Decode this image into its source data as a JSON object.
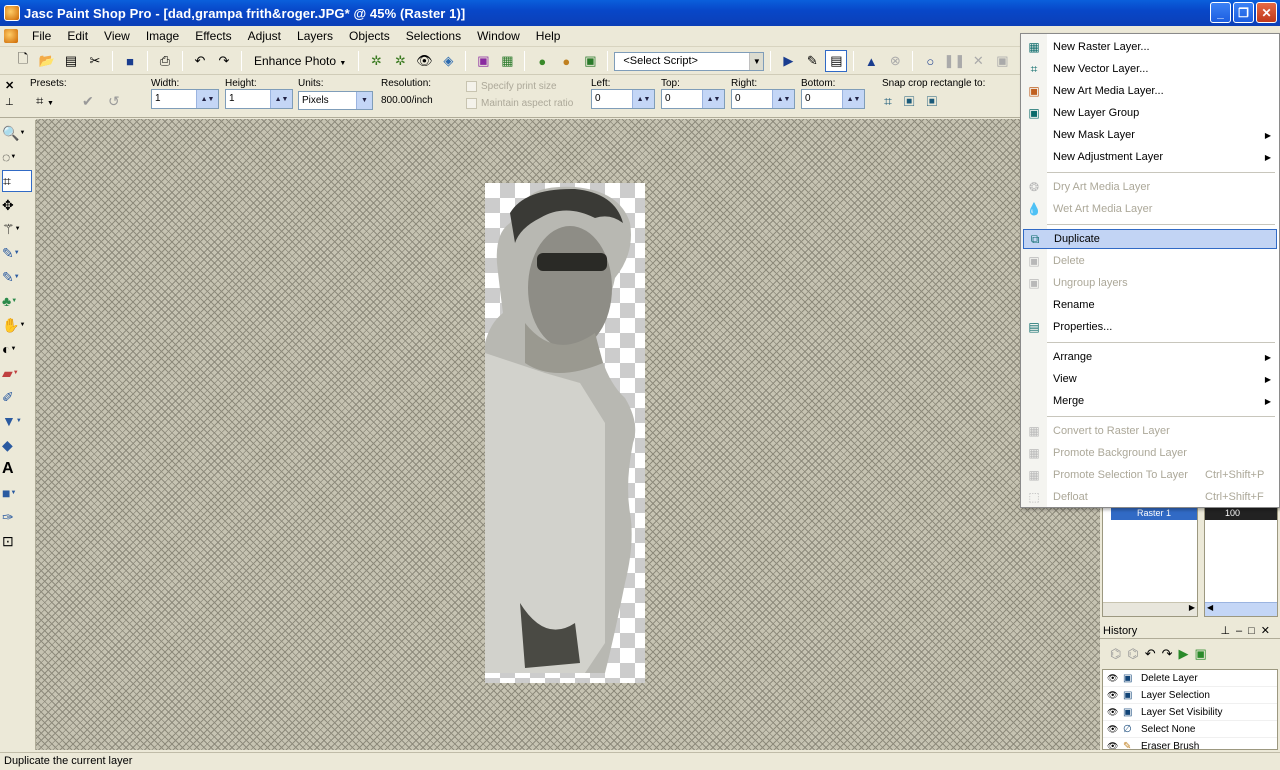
{
  "window": {
    "title": "Jasc Paint Shop Pro - [dad,grampa frith&roger.JPG* @  45% (Raster 1)]",
    "min": "_",
    "max": "❐",
    "close": "✕"
  },
  "menubar": [
    "File",
    "Edit",
    "View",
    "Image",
    "Effects",
    "Adjust",
    "Layers",
    "Objects",
    "Selections",
    "Window",
    "Help"
  ],
  "toolbar": {
    "enhance": "Enhance Photo",
    "enhance_arrow": "▼",
    "script": "<Select Script>"
  },
  "options": {
    "presets_label": "Presets:",
    "width_label": "Width:",
    "width_val": "1",
    "height_label": "Height:",
    "height_val": "1",
    "units_label": "Units:",
    "units_val": "Pixels",
    "resolution_label": "Resolution:",
    "resolution_val": "800.00/inch",
    "specify_print": "Specify print size",
    "maintain_aspect": "Maintain aspect ratio",
    "left_label": "Left:",
    "left_val": "0",
    "top_label": "Top:",
    "top_val": "0",
    "right_label": "Right:",
    "right_val": "0",
    "bottom_label": "Bottom:",
    "bottom_val": "0",
    "snap_label": "Snap crop rectangle to:"
  },
  "layers_panel": {
    "layer_name": "Raster 1",
    "opacity": "100"
  },
  "history": {
    "title": "History",
    "items": [
      "Delete Layer",
      "Layer Selection",
      "Layer Set Visibility",
      "Select None",
      "Eraser Brush"
    ]
  },
  "context_menu": {
    "new_raster": "New Raster Layer...",
    "new_vector": "New Vector Layer...",
    "new_art_media": "New Art Media Layer...",
    "new_group": "New Layer Group",
    "new_mask": "New Mask Layer",
    "new_adjustment": "New Adjustment Layer",
    "dry_art": "Dry Art Media Layer",
    "wet_art": "Wet Art Media Layer",
    "duplicate": "Duplicate",
    "delete": "Delete",
    "ungroup": "Ungroup layers",
    "rename": "Rename",
    "properties": "Properties...",
    "arrange": "Arrange",
    "view": "View",
    "merge": "Merge",
    "convert_raster": "Convert to Raster Layer",
    "promote_bg": "Promote Background Layer",
    "promote_sel": "Promote Selection To Layer",
    "promote_sel_sc": "Ctrl+Shift+P",
    "defloat": "Defloat",
    "defloat_sc": "Ctrl+Shift+F",
    "submenu_arrow": "▶"
  },
  "status": "Duplicate the current layer"
}
